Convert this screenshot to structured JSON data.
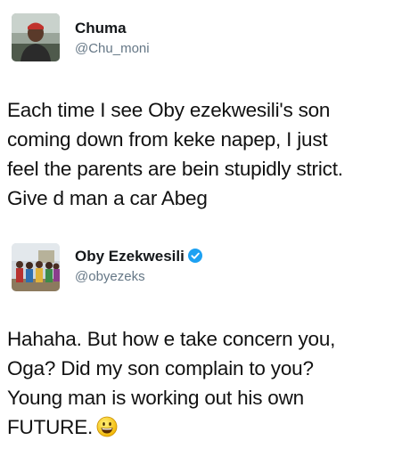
{
  "tweets": [
    {
      "display_name": "Chuma",
      "handle": "@Chu_moni",
      "avatar_icon": "profile-photo",
      "verified": false,
      "text_lines": [
        "Each time I see Oby ezekwesili's son",
        "coming down from keke napep, I just",
        "feel the parents are bein stupidly strict.",
        "Give d man a car Abeg"
      ]
    },
    {
      "display_name": "Oby Ezekwesili",
      "handle": "@obyezeks",
      "avatar_icon": "profile-photo-crowd",
      "verified": true,
      "verified_color": "#1da1f2",
      "text_lines": [
        "Hahaha. But how e take concern you,",
        "Oga? Did my son complain to you?",
        "Young man is working out his own",
        "FUTURE."
      ],
      "trailing_icon": "grinning-emoji"
    }
  ]
}
